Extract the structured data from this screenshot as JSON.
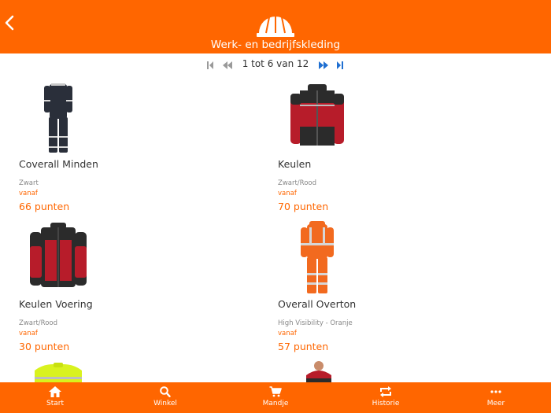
{
  "header": {
    "title": "Werk- en bedrijfskleding",
    "back_icon": "chevron-left-icon",
    "logo_icon": "hard-hat-logo"
  },
  "pagination": {
    "info": "1 tot 6 van 12"
  },
  "products": [
    {
      "name": "Coverall Minden",
      "color": "Zwart",
      "vanaf": "vanaf",
      "price": "66 punten",
      "image": "black-coverall"
    },
    {
      "name": "Keulen",
      "color": "Zwart/Rood",
      "vanaf": "vanaf",
      "price": "70 punten",
      "image": "red-black-jacket"
    },
    {
      "name": "Keulen Voering",
      "color": "Zwart/Rood",
      "vanaf": "vanaf",
      "price": "30 punten",
      "image": "red-black-fleece"
    },
    {
      "name": "Overall Overton",
      "color": "High Visibility - Oranje",
      "vanaf": "vanaf",
      "price": "57 punten",
      "image": "orange-hi-vis-overall"
    }
  ],
  "tabs": [
    {
      "label": "Start",
      "icon": "home-icon"
    },
    {
      "label": "Winkel",
      "icon": "search-icon"
    },
    {
      "label": "Mandje",
      "icon": "cart-icon"
    },
    {
      "label": "Historie",
      "icon": "repeat-icon"
    },
    {
      "label": "Meer",
      "icon": "more-dots-icon"
    }
  ],
  "colors": {
    "accent": "#ff6600",
    "pager_active": "#1f6fd1",
    "pager_disabled": "#9a9a9a"
  }
}
